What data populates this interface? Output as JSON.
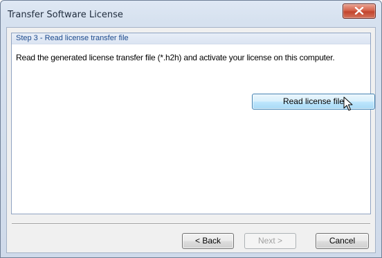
{
  "window": {
    "title": "Transfer Software License",
    "close_icon": "close-x-icon"
  },
  "step": {
    "header": "Step 3 - Read license transfer file",
    "description": "Read the generated license transfer file (*.h2h) and activate your license on this computer.",
    "read_button_label": "Read license file"
  },
  "footer": {
    "back_label": "< Back",
    "next_label": "Next >",
    "cancel_label": "Cancel"
  },
  "colors": {
    "close_button": "#c9503a",
    "step_header_text": "#1c4a8c",
    "read_button_hover": "#bee6fd"
  }
}
